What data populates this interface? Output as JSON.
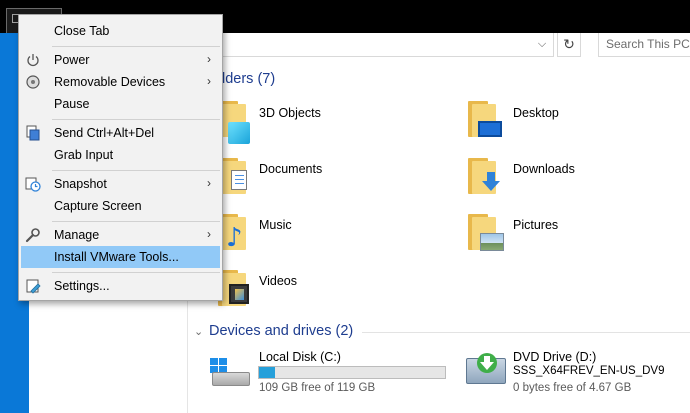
{
  "tab": {
    "icon": "vm-tab-icon"
  },
  "address": {
    "dropdown_glyph": "⌵",
    "refresh_glyph": "↻",
    "search_placeholder": "Search This PC"
  },
  "folders_section": {
    "heading_partial": "lders (7)",
    "chevron": "⌄"
  },
  "folders": [
    {
      "label": "3D Objects"
    },
    {
      "label": "Desktop"
    },
    {
      "label": "Documents"
    },
    {
      "label": "Downloads"
    },
    {
      "label": "Music"
    },
    {
      "label": "Pictures"
    },
    {
      "label": "Videos"
    }
  ],
  "devices_section": {
    "heading": "Devices and drives (2)",
    "chevron": "⌄"
  },
  "drives": [
    {
      "label": "Local Disk (C:)",
      "free_text": "109 GB free of 119 GB",
      "used_fraction": 0.084
    },
    {
      "label": "DVD Drive (D:)",
      "volume": "SSS_X64FREV_EN-US_DV9",
      "free_text": "0 bytes free of 4.67 GB",
      "used_fraction": 1.0
    }
  ],
  "menu": {
    "items": [
      {
        "label": "Close Tab",
        "icon": "",
        "submenu": false
      },
      {
        "label": "Power",
        "icon": "power-icon",
        "submenu": true
      },
      {
        "label": "Removable Devices",
        "icon": "removable-devices-icon",
        "submenu": true
      },
      {
        "label": "Pause",
        "icon": "",
        "submenu": false
      },
      {
        "label": "Send Ctrl+Alt+Del",
        "icon": "keyboard-icon",
        "submenu": false
      },
      {
        "label": "Grab Input",
        "icon": "",
        "submenu": false
      },
      {
        "label": "Snapshot",
        "icon": "snapshot-icon",
        "submenu": true
      },
      {
        "label": "Capture Screen",
        "icon": "",
        "submenu": false
      },
      {
        "label": "Manage",
        "icon": "wrench-icon",
        "submenu": true
      },
      {
        "label": "Install VMware Tools...",
        "icon": "",
        "submenu": false,
        "highlighted": true
      },
      {
        "label": "Settings...",
        "icon": "settings-icon",
        "submenu": false
      }
    ],
    "submenu_glyph": "›",
    "highlight_color": "#91c9f7"
  },
  "colors": {
    "section_heading": "#1e3d8f",
    "progress": "#26a0da",
    "vm_strip": "#0a78d7"
  }
}
